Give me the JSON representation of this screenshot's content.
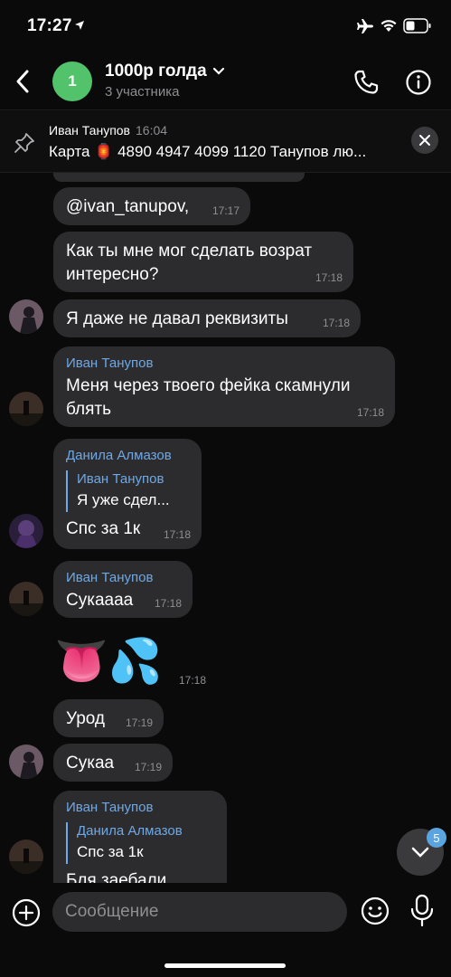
{
  "status_bar": {
    "time": "17:27"
  },
  "header": {
    "avatar_letter": "1",
    "title": "1000р голда",
    "subtitle": "3 участника"
  },
  "pinned": {
    "author": "Иван Танупов",
    "time": "16:04",
    "text": "Карта 🏮 4890 4947 4099 1120 Танупов лю..."
  },
  "messages": [
    {
      "text": "@ivan_tanupov,",
      "time": "17:17"
    },
    {
      "text": "Как ты мне мог сделать возрат интересно?",
      "time": "17:18"
    },
    {
      "text": "Я даже не давал реквизиты",
      "time": "17:18"
    },
    {
      "sender": "Иван Танупов",
      "text": "Меня через твоего фейка скамнули блять",
      "time": "17:18"
    },
    {
      "sender": "Данила Алмазов",
      "reply_author": "Иван Танупов",
      "reply_text": "Я уже сдел...",
      "text": "Спс за 1к",
      "time": "17:18"
    },
    {
      "sender": "Иван Танупов",
      "text": "Сукаааа",
      "time": "17:18"
    },
    {
      "text": "👅💦",
      "time": "17:18"
    },
    {
      "text": "Урод",
      "time": "17:19"
    },
    {
      "text": "Сукаа",
      "time": "17:19"
    },
    {
      "sender": "Иван Танупов",
      "reply_author": "Данила Алмазов",
      "reply_text": "Спс за 1к",
      "text": "Бля заебали",
      "time": ""
    }
  ],
  "scroll": {
    "unread_count": "5"
  },
  "input": {
    "placeholder": "Сообщение"
  },
  "colors": {
    "accent": "#6ea8e6",
    "bubble": "#2c2c2e",
    "avatar_green": "#52c26b",
    "background": "#0a0a0a"
  }
}
